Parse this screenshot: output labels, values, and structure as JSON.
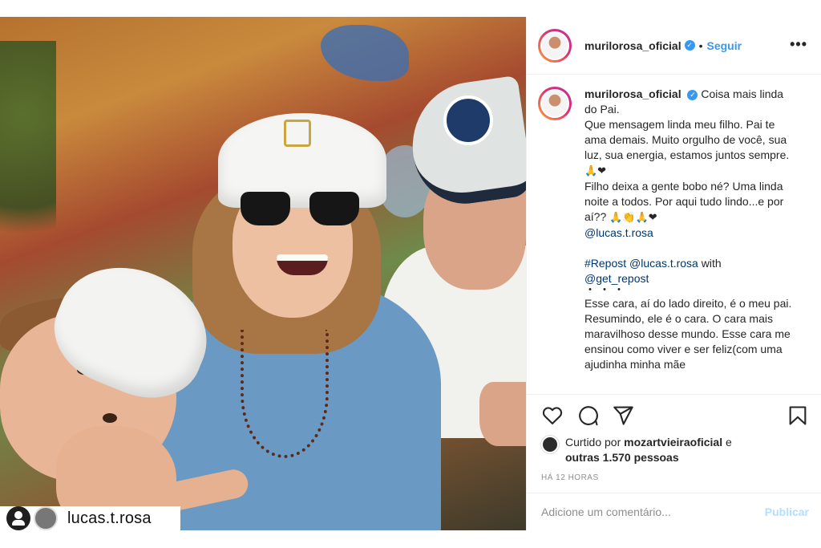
{
  "photo": {
    "credit_username": "lucas.t.rosa",
    "credit_icon": "repost-user-icon"
  },
  "header": {
    "username": "murilorosa_oficial",
    "verified_glyph": "✓",
    "separator": "•",
    "follow_label": "Seguir",
    "more_label": "•••"
  },
  "caption": {
    "username": "murilorosa_oficial",
    "lines": {
      "first": "Coisa mais linda do Pai.",
      "p1": "Que mensagem linda meu filho. Pai te ama demais. Muito orgulho de você, sua luz, sua energia, estamos juntos sempre.",
      "p1_emoji": "🙏❤",
      "p2": "Filho deixa a gente bobo né? Uma linda noite a todos. Por aqui tudo lindo...e por aí??",
      "p2_emoji": "🙏👏🙏❤",
      "mention1": "@lucas.t.rosa",
      "repost_tag": "#Repost",
      "repost_mention": "@lucas.t.rosa",
      "repost_with": "with",
      "repost_app": "@get_repost",
      "dots": "・・・",
      "p3": "Esse cara, aí do lado direito, é o meu pai. Resumindo, ele é o cara. O cara mais maravilhoso desse mundo. Esse cara me ensinou como viver e ser feliz(com uma ajudinha minha mãe"
    }
  },
  "likes": {
    "prefix": "Curtido por",
    "first_user": "mozartvieiraoficial",
    "conjunction": "e",
    "others": "outras 1.570 pessoas"
  },
  "timestamp": "HÁ 12 HORAS",
  "comment_box": {
    "placeholder": "Adicione um comentário...",
    "publish_label": "Publicar"
  },
  "colors": {
    "accent": "#3897f0",
    "publish_disabled": "#b2dffc",
    "muted": "#8e8e8e",
    "text": "#262626",
    "mention": "#00376b"
  },
  "icons": [
    "heart-icon",
    "comment-icon",
    "share-icon",
    "bookmark-icon",
    "verified-badge-icon",
    "more-options-icon"
  ]
}
